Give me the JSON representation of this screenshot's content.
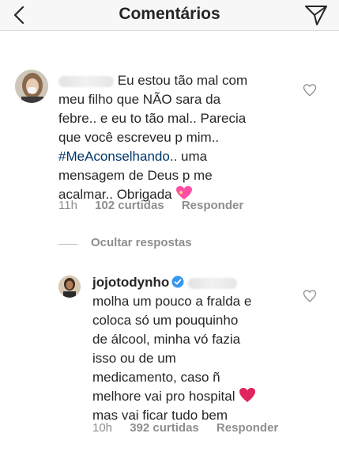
{
  "header": {
    "title": "Comentários"
  },
  "comment1": {
    "text_lines": [
      "Eu estou tão mal com",
      "meu filho que NÃO sara da",
      "febre.. e eu to tão mal.. Parecia",
      "que você escreveu p mim.."
    ],
    "hashtag": "#MeAconselhando",
    "text_after_hashtag": ".. uma",
    "text_tail": [
      "mensagem de Deus p me",
      "acalmar.. Obrigada"
    ],
    "emoji": "sparkling-heart",
    "time": "11h",
    "likes": "102 curtidas",
    "reply_label": "Responder"
  },
  "hide_replies_label": "Ocultar respostas",
  "reply1": {
    "username": "jojotodynho",
    "text_lines": [
      "molha um pouco  a fralda e",
      "coloca  só  um pouquinho",
      "de álcool, minha vó  fazia",
      "isso ou de um",
      "medicamento, caso ñ",
      "melhore vai pro hospital"
    ],
    "text_last": "mas vai ficar tudo bem",
    "emoji": "red-heart",
    "time": "10h",
    "likes": "392 curtidas",
    "reply_label": "Responder"
  },
  "colors": {
    "hashtag": "#003569",
    "meta": "#8e8e8e",
    "verified": "#3897f0",
    "heart_emoji": "#e0245e"
  }
}
